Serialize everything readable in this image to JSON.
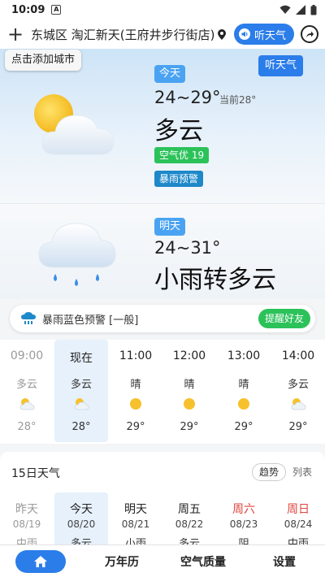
{
  "status_bar": {
    "time": "10:09",
    "notif_glyph": "A"
  },
  "top_bar": {
    "add_icon": "plus-icon",
    "city": "东城区 淘汇新天(王府井步行街店)",
    "location_icon": "location-pin-icon",
    "listen_label": "听天气",
    "share_icon": "share-icon"
  },
  "tooltip_add_city": "点击添加城市",
  "listen_bubble": "听天气",
  "today": {
    "label": "今天",
    "temp_range": "24~29°",
    "current": "当前28°",
    "condition": "多云",
    "aqi": "空气优 19",
    "alert": "暴雨预警",
    "icon": "partly-cloudy-icon"
  },
  "tomorrow": {
    "label": "明天",
    "temp_range": "24~31°",
    "condition": "小雨转多云",
    "icon": "rain-cloud-icon"
  },
  "warning": {
    "icon": "storm-warning-icon",
    "text": "暴雨蓝色预警 [一般]",
    "button": "提醒好友"
  },
  "hourly": [
    {
      "time": "09:00",
      "cond": "多云",
      "icon": "partly-cloudy-icon",
      "temp": "28°",
      "past": true
    },
    {
      "time": "现在",
      "cond": "多云",
      "icon": "partly-cloudy-icon",
      "temp": "28°",
      "active": true
    },
    {
      "time": "11:00",
      "cond": "晴",
      "icon": "sun-icon",
      "temp": "29°"
    },
    {
      "time": "12:00",
      "cond": "晴",
      "icon": "sun-icon",
      "temp": "29°"
    },
    {
      "time": "13:00",
      "cond": "晴",
      "icon": "sun-icon",
      "temp": "29°"
    },
    {
      "time": "14:00",
      "cond": "多云",
      "icon": "partly-cloudy-icon",
      "temp": "29°"
    }
  ],
  "daily": {
    "title": "15日天气",
    "trend": "趋势",
    "list": "列表",
    "days": [
      {
        "name": "昨天",
        "date": "08/19",
        "cond": "中雨",
        "past": true
      },
      {
        "name": "今天",
        "date": "08/20",
        "cond": "多云",
        "active": true
      },
      {
        "name": "明天",
        "date": "08/21",
        "cond": "小雨"
      },
      {
        "name": "周五",
        "date": "08/22",
        "cond": "多云"
      },
      {
        "name": "周六",
        "date": "08/23",
        "cond": "阴",
        "weekend": true
      },
      {
        "name": "周日",
        "date": "08/24",
        "cond": "中雨",
        "weekend": true
      }
    ]
  },
  "bottom_nav": {
    "home_icon": "home-icon",
    "items": [
      "万年历",
      "空气质量",
      "设置"
    ]
  },
  "colors": {
    "accent": "#2b7de9",
    "green": "#2bc25a",
    "weekend": "#e0443e"
  }
}
